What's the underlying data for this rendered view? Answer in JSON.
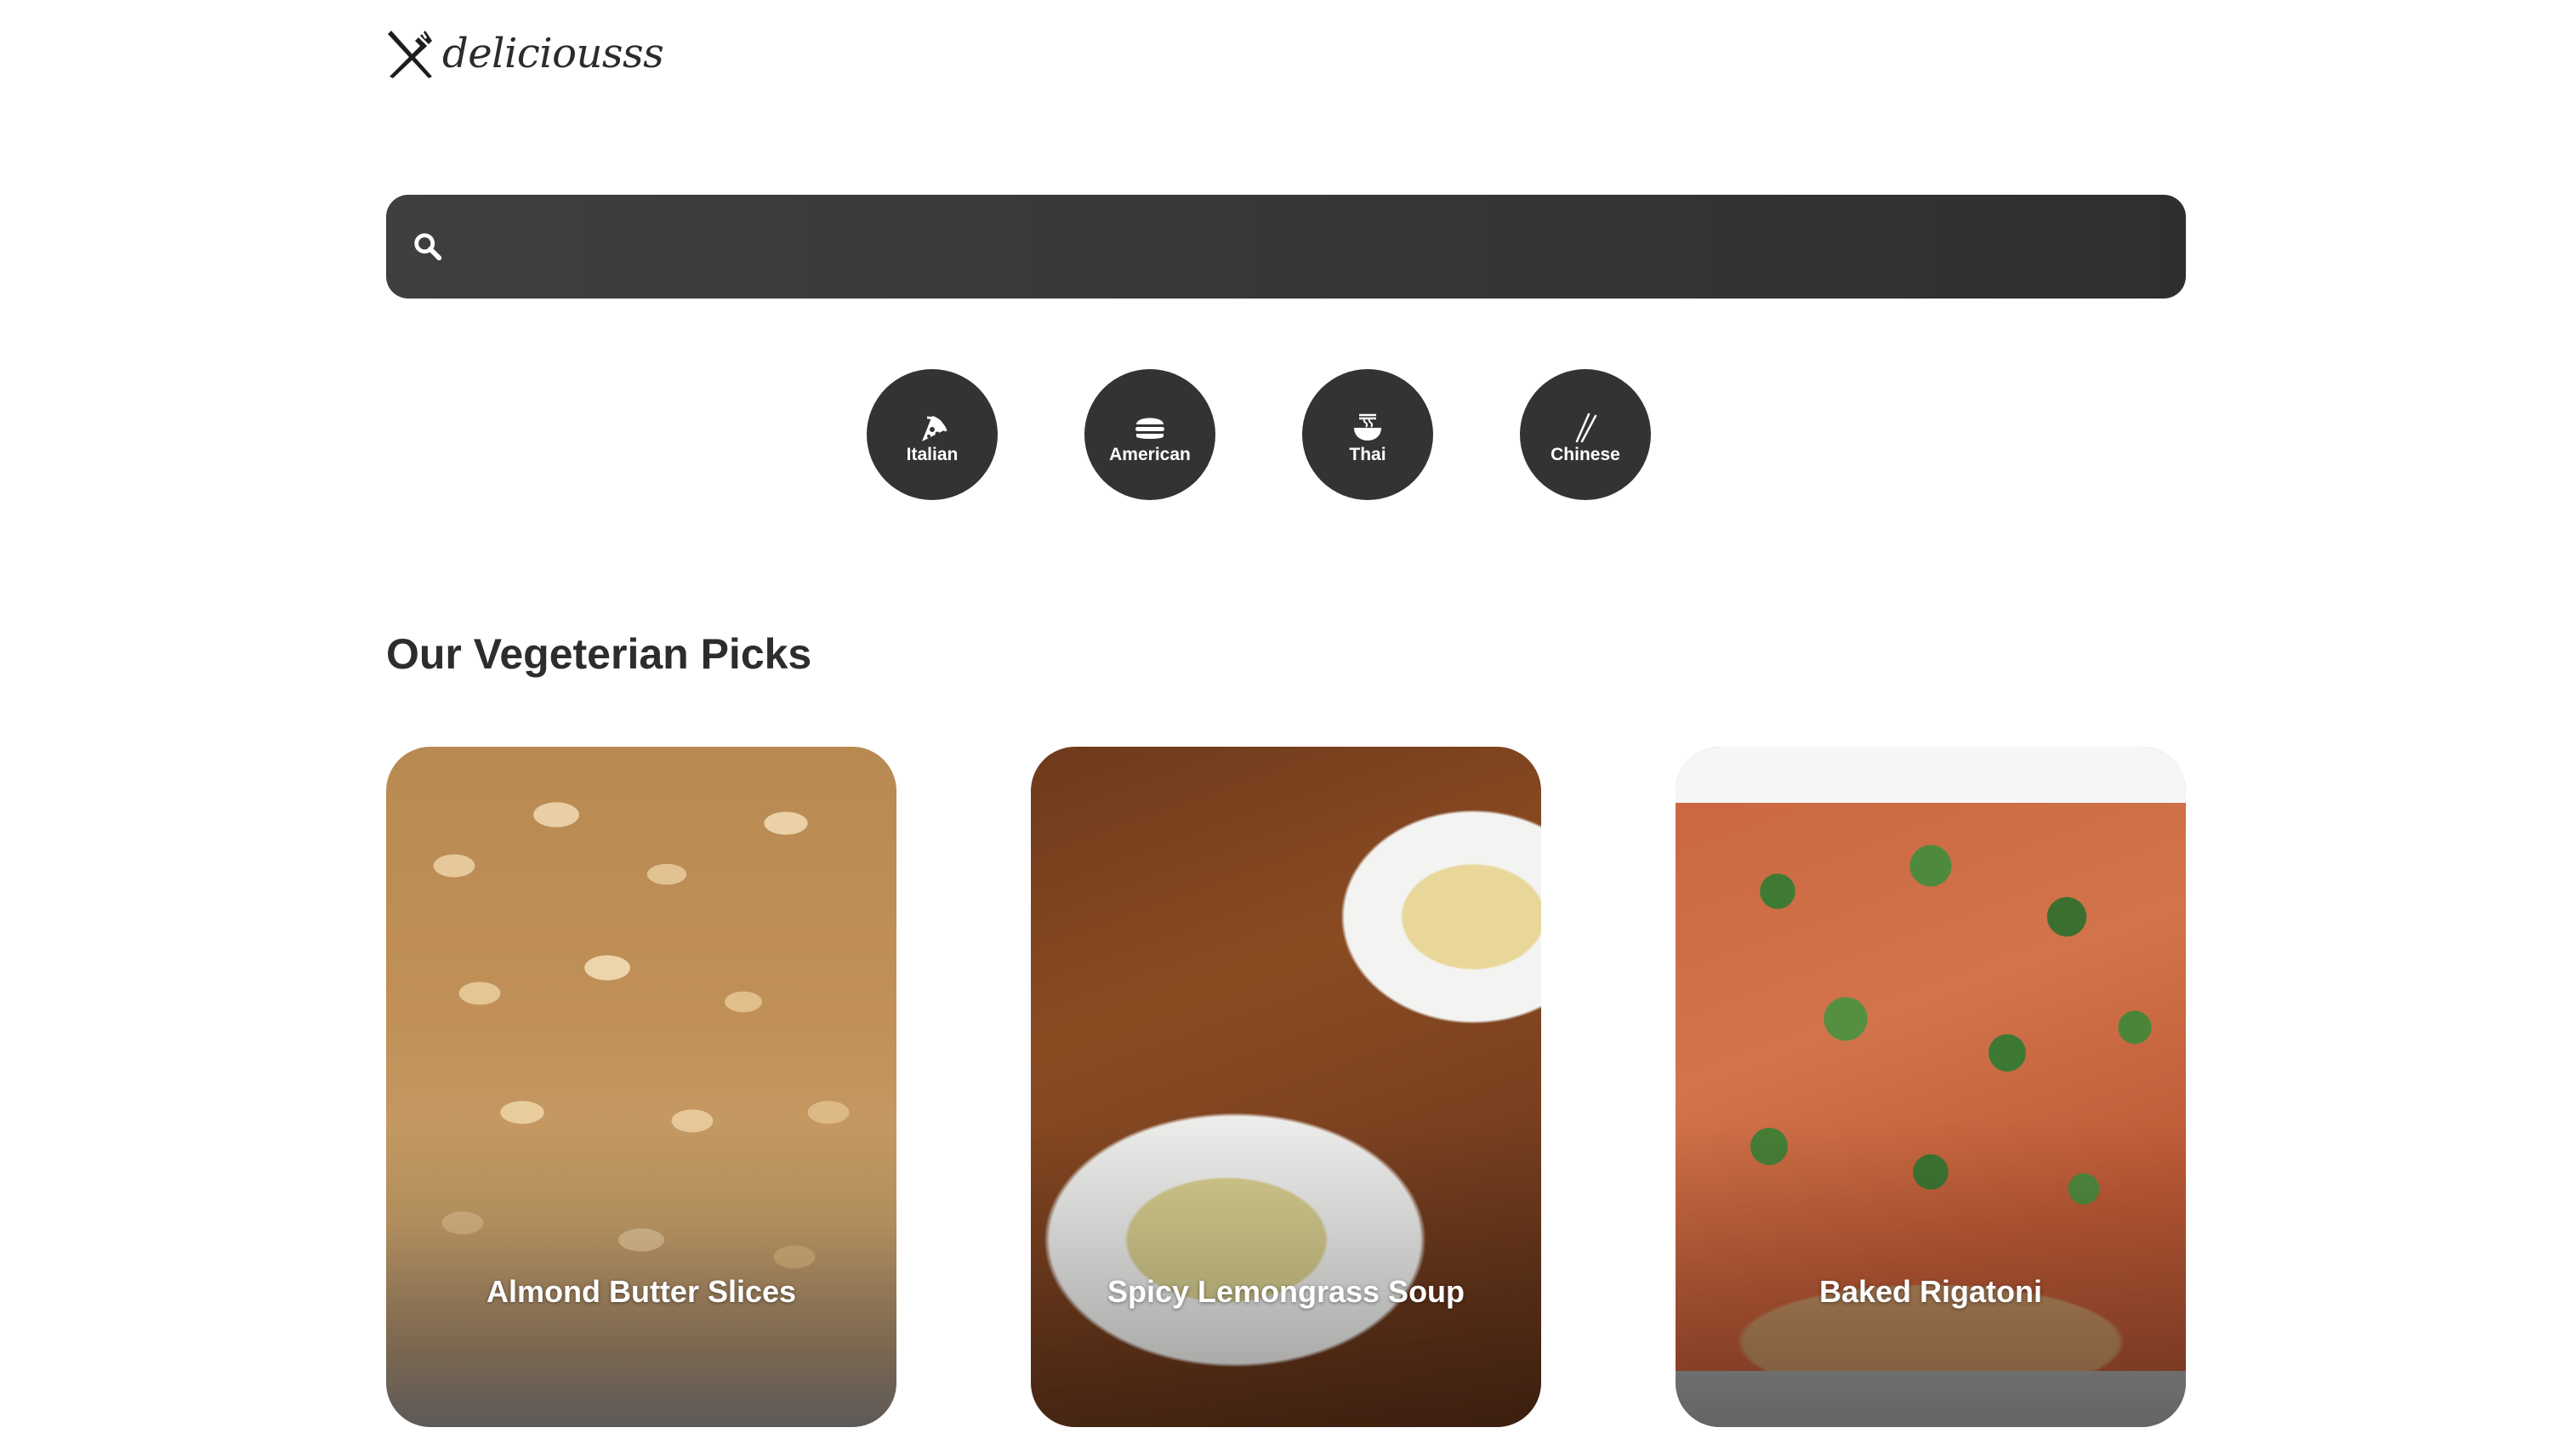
{
  "brand": {
    "name": "deliciousss",
    "logo_icon": "fork-knife-icon"
  },
  "search": {
    "placeholder": "",
    "value": "",
    "icon": "search-icon"
  },
  "categories": [
    {
      "label": "Italian",
      "icon": "pizza-icon"
    },
    {
      "label": "American",
      "icon": "hamburger-icon"
    },
    {
      "label": "Thai",
      "icon": "noodle-bowl-icon"
    },
    {
      "label": "Chinese",
      "icon": "chopsticks-icon"
    }
  ],
  "section": {
    "title": "Our Vegeterian Picks"
  },
  "recipes": [
    {
      "title": "Almond Butter Slices"
    },
    {
      "title": "Spicy Lemongrass Soup"
    },
    {
      "title": "Baked Rigatoni"
    }
  ],
  "colors": {
    "search_bg": "#333333",
    "category_bg": "#333333",
    "text": "#2d2d2d",
    "card_title": "#ffffff"
  }
}
